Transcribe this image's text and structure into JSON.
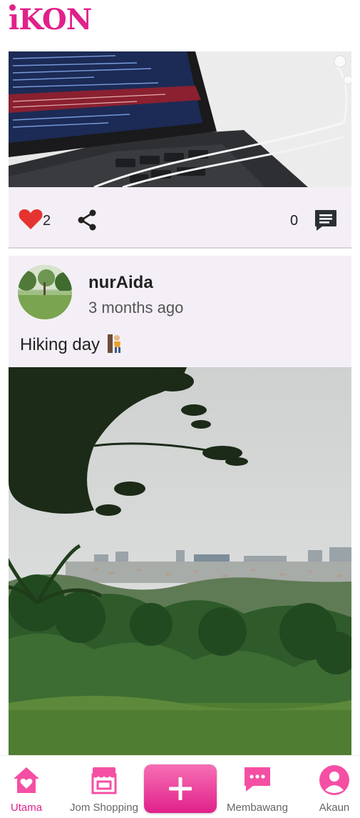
{
  "app": {
    "logo": "iKON",
    "accent_color": "#e0218a"
  },
  "posts": [
    {
      "likes": "2",
      "comments": "0",
      "icons": {
        "like": "heart-icon",
        "share": "share-icon",
        "comment": "comment-icon"
      }
    },
    {
      "username": "nurAida",
      "time": "3 months ago",
      "caption": "Hiking day",
      "caption_emoji": "person-climbing-icon"
    }
  ],
  "nav": {
    "items": [
      {
        "label": "Utama",
        "icon": "home-icon",
        "active": true
      },
      {
        "label": "Jom Shopping",
        "icon": "store-icon"
      },
      {
        "label": "",
        "icon": "plus-icon"
      },
      {
        "label": "Membawang",
        "icon": "chat-icon"
      },
      {
        "label": "Akaun",
        "icon": "user-icon"
      }
    ]
  }
}
